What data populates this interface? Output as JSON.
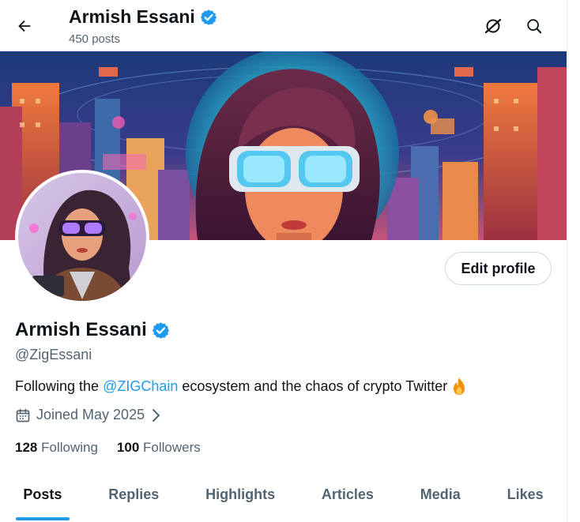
{
  "header": {
    "title": "Armish Essani",
    "post_count": "450 posts"
  },
  "profile": {
    "name": "Armish Essani",
    "handle": "@ZigEssani",
    "bio_before": "Following the ",
    "bio_mention": "@ZIGChain",
    "bio_after": " ecosystem and the chaos of crypto Twitter",
    "bio_emoji": "fire-emoji",
    "joined": "Joined May 2025",
    "following_count": "128",
    "following_label": "Following",
    "followers_count": "100",
    "followers_label": "Followers",
    "edit_label": "Edit profile",
    "verified": true
  },
  "tabs": [
    {
      "label": "Posts",
      "active": true
    },
    {
      "label": "Replies",
      "active": false
    },
    {
      "label": "Highlights",
      "active": false
    },
    {
      "label": "Articles",
      "active": false
    },
    {
      "label": "Media",
      "active": false
    },
    {
      "label": "Likes",
      "active": false
    }
  ],
  "icons": {
    "back": "arrow-left-icon",
    "grok": "grok-icon",
    "search": "search-icon",
    "verified": "verified-badge-icon",
    "calendar": "calendar-icon",
    "chevron": "chevron-right-icon"
  },
  "colors": {
    "accent": "#1d9bf0",
    "text_primary": "#0f1419",
    "text_secondary": "#536471",
    "border": "#cfd9de"
  }
}
